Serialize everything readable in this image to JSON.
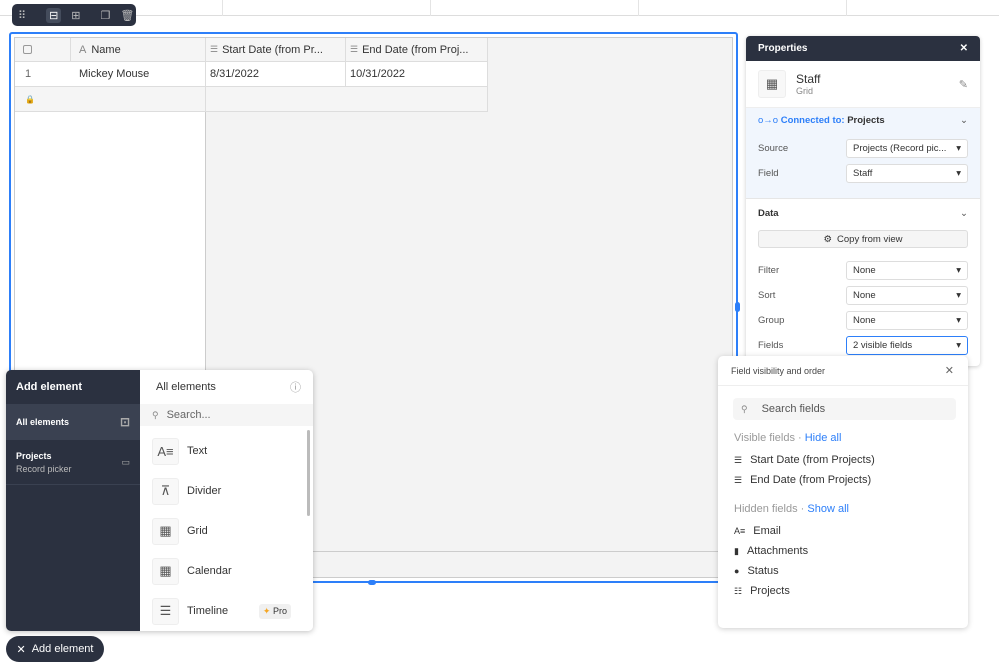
{
  "toolbar": {
    "icons": [
      "drag-handle-icon",
      "full-width-icon",
      "fit-width-icon",
      "duplicate-icon",
      "trash-icon"
    ]
  },
  "grid": {
    "columns": [
      {
        "label": "Name",
        "icon": "text-icon"
      },
      {
        "label": "Start Date (from Pr...",
        "icon": "lookup-icon"
      },
      {
        "label": "End Date (from Proj...",
        "icon": "lookup-icon"
      }
    ],
    "rows": [
      {
        "num": "1",
        "name": "Mickey Mouse",
        "start": "8/31/2022",
        "end": "10/31/2022"
      }
    ]
  },
  "properties": {
    "title": "Properties",
    "element_name": "Staff",
    "element_type": "Grid",
    "connected_label": "Connected to:",
    "connected_value": "Projects",
    "source_label": "Source",
    "source_value": "Projects (Record pic...",
    "field_label": "Field",
    "field_value": "Staff",
    "data_label": "Data",
    "copy_label": "Copy from view",
    "filter_label": "Filter",
    "filter_value": "None",
    "sort_label": "Sort",
    "sort_value": "None",
    "group_label": "Group",
    "group_value": "None",
    "fields_label": "Fields",
    "fields_value": "2 visible fields"
  },
  "field_visibility": {
    "title": "Field visibility and order",
    "search_placeholder": "Search fields",
    "visible_label": "Visible fields ·",
    "hide_all": "Hide all",
    "visible": [
      "Start Date (from Projects)",
      "End Date (from Projects)"
    ],
    "hidden_label": "Hidden fields ·",
    "show_all": "Show all",
    "hidden": [
      "Email",
      "Attachments",
      "Status",
      "Projects"
    ]
  },
  "add_element": {
    "title": "Add element",
    "categories": [
      {
        "label": "All elements"
      },
      {
        "label": "Projects",
        "sub": "Record picker"
      }
    ],
    "list_title": "All elements",
    "search_placeholder": "Search...",
    "items": [
      "Text",
      "Divider",
      "Grid",
      "Calendar",
      "Timeline"
    ],
    "pro_badge": "Pro",
    "button_label": "Add element"
  },
  "colors": {
    "accent": "#2d7ff9",
    "dark": "#2b3140"
  }
}
